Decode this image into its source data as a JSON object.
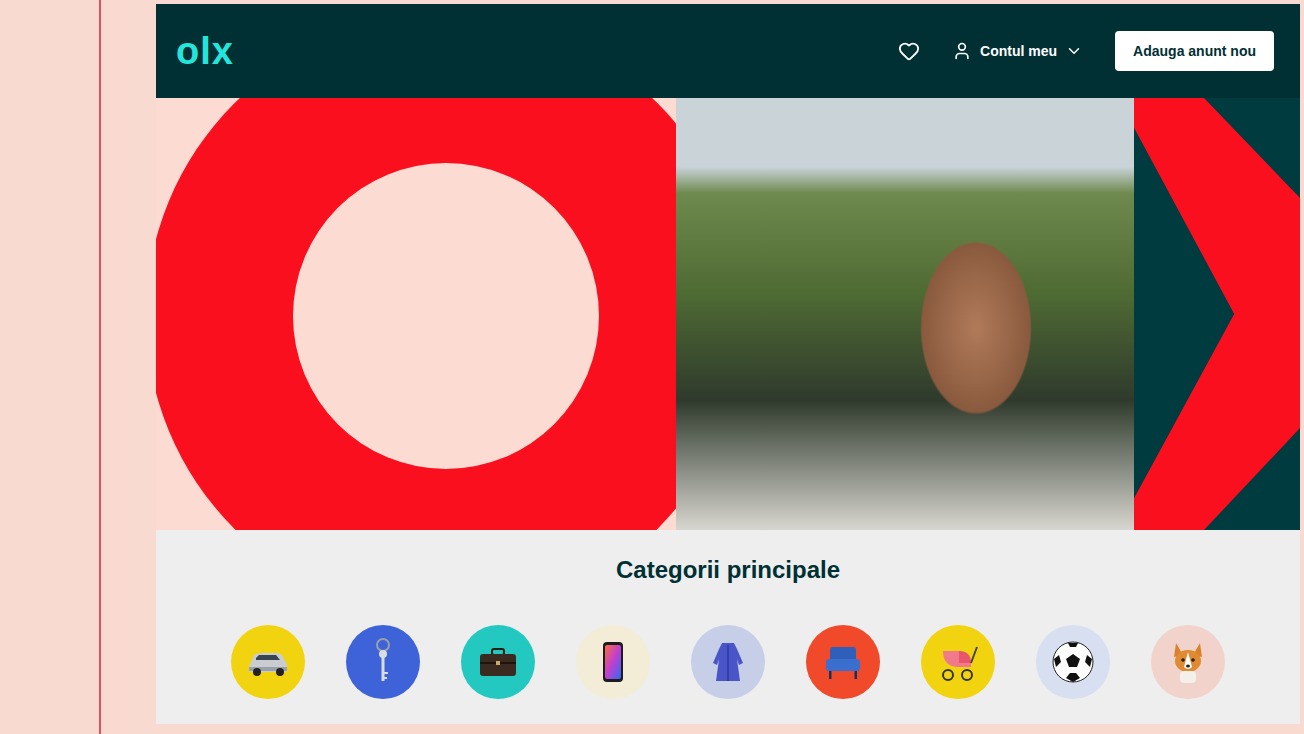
{
  "header": {
    "logo": "olx",
    "account": "Contul meu",
    "post_button": "Adauga anunt nou"
  },
  "categories": {
    "title": "Categorii principale",
    "items": [
      {
        "kind": "car",
        "color": "#f2d30f"
      },
      {
        "kind": "key",
        "color": "#3e63d8"
      },
      {
        "kind": "briefcase",
        "color": "#23c8c0"
      },
      {
        "kind": "phone",
        "color": "#f3ecd6"
      },
      {
        "kind": "dress",
        "color": "#c7cfe8"
      },
      {
        "kind": "chair",
        "color": "#f04a2b"
      },
      {
        "kind": "stroller",
        "color": "#f2d30f"
      },
      {
        "kind": "ball",
        "color": "#d7dff0"
      },
      {
        "kind": "dog",
        "color": "#f2d3cc"
      }
    ]
  }
}
